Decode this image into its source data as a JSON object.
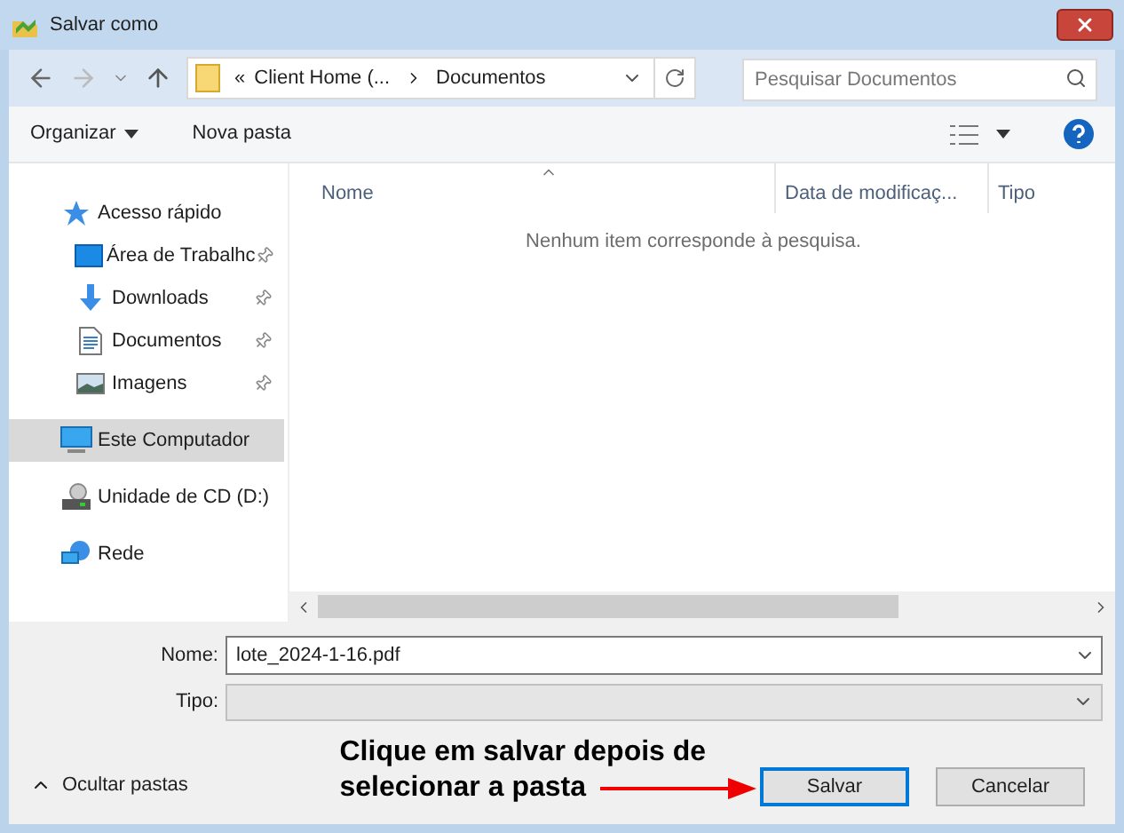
{
  "window": {
    "title": "Salvar como"
  },
  "address": {
    "overflow_marker": "«",
    "parent": "Client Home (...",
    "current": "Documentos"
  },
  "search": {
    "placeholder": "Pesquisar Documentos"
  },
  "commands": {
    "organize": "Organizar",
    "new_folder": "Nova pasta"
  },
  "columns": [
    {
      "label": "Nome",
      "sorted": true
    },
    {
      "label": "Data de modificaç...",
      "sorted": false
    },
    {
      "label": "Tipo",
      "sorted": false
    }
  ],
  "empty_message": "Nenhum item corresponde à pesquisa.",
  "sidebar": {
    "items": [
      {
        "kind": "quick-access",
        "label": "Acesso rápido",
        "selected": false,
        "children": [
          {
            "kind": "desktop",
            "label": "Área de Trabalhc",
            "pinned": true,
            "selected": false
          },
          {
            "kind": "downloads",
            "label": "Downloads",
            "pinned": true,
            "selected": false
          },
          {
            "kind": "documents",
            "label": "Documentos",
            "pinned": true,
            "selected": false
          },
          {
            "kind": "images",
            "label": "Imagens",
            "pinned": true,
            "selected": false
          }
        ]
      },
      {
        "kind": "computer",
        "label": "Este Computador",
        "selected": true
      },
      {
        "kind": "cd-drive",
        "label": "Unidade de CD (D:)",
        "selected": false
      },
      {
        "kind": "network",
        "label": "Rede",
        "selected": false
      }
    ]
  },
  "form": {
    "name_label": "Nome:",
    "name_value": "lote_2024-1-16.pdf",
    "type_label": "Tipo:"
  },
  "hide_folders": "Ocultar pastas",
  "buttons": [
    {
      "label": "Salvar",
      "default": true
    },
    {
      "label": "Cancelar",
      "default": false
    }
  ],
  "annotation_lines": [
    "Clique em salvar depois de",
    "selecionar a pasta"
  ]
}
